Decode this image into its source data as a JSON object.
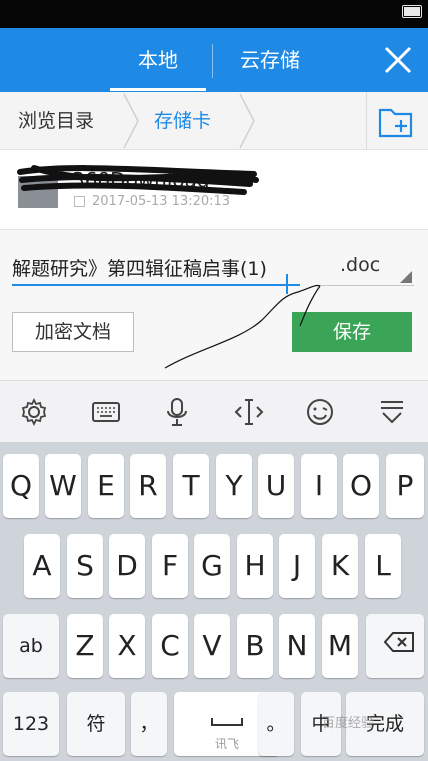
{
  "header": {
    "tabs": [
      {
        "label": "本地",
        "active": true
      },
      {
        "label": "云存储",
        "active": false
      }
    ],
    "close_icon": "close-icon",
    "bg_color": "#1e8ae6"
  },
  "breadcrumb": {
    "root_label": "浏览目录",
    "current_label": "存储卡",
    "new_folder_icon": "new-folder-icon"
  },
  "file_list": [
    {
      "name": "360Download",
      "date": "2017-05-13 13:20:13",
      "icon": "folder-icon"
    }
  ],
  "save_form": {
    "filename_value": "解题研究》第四辑征稿启事(1)",
    "extension_selected": ".doc",
    "encrypt_button_label": "加密文档",
    "save_button_label": "保存",
    "save_button_color": "#3aa556"
  },
  "keyboard_toolbar": {
    "icons": [
      "gear-icon",
      "keyboard-icon",
      "microphone-icon",
      "cursor-move-icon",
      "emoji-icon",
      "hide-keyboard-icon"
    ]
  },
  "keyboard": {
    "row1": [
      "Q",
      "W",
      "E",
      "R",
      "T",
      "Y",
      "U",
      "I",
      "O",
      "P"
    ],
    "row2": [
      "A",
      "S",
      "D",
      "F",
      "G",
      "H",
      "J",
      "K",
      "L"
    ],
    "row3": [
      "Z",
      "X",
      "C",
      "V",
      "B",
      "N",
      "M"
    ],
    "abc_label": "ab",
    "num_label": "123",
    "symbol_label": "符",
    "comma_label": "，",
    "space_sub_label": "讯飞",
    "period_label": "。",
    "lang_label": "中",
    "done_label": "完成"
  },
  "watermark": "百度经验"
}
